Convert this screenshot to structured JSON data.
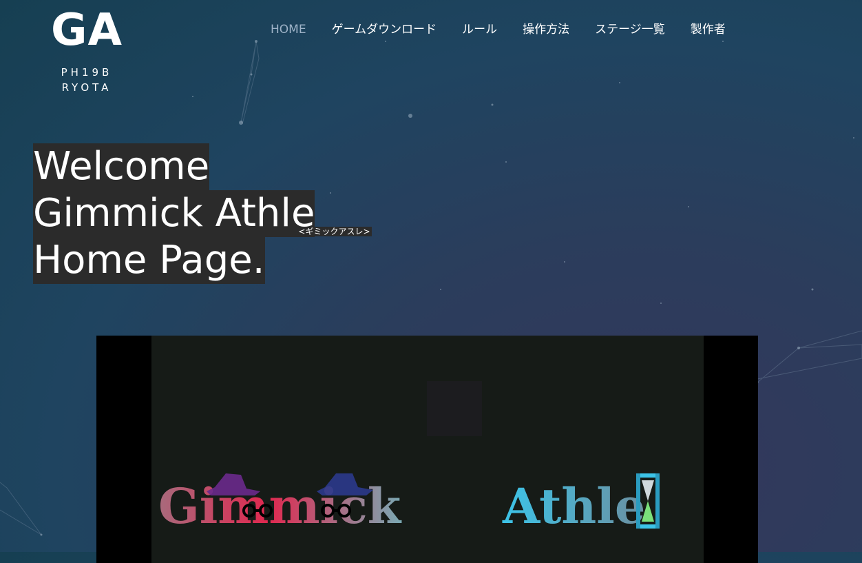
{
  "logo": {
    "main": "GA",
    "line1": "PH19B",
    "line2": "RYOTA"
  },
  "nav": [
    {
      "label": "HOME",
      "active": true
    },
    {
      "label": "ゲームダウンロード"
    },
    {
      "label": "ルール"
    },
    {
      "label": "操作方法"
    },
    {
      "label": "ステージ一覧"
    },
    {
      "label": "製作者"
    }
  ],
  "hero": {
    "line1": "Welcome ",
    "line2": "Gimmick Athle",
    "ruby": "<ギミックアスレ>",
    "line3": "Home Page."
  },
  "video": {
    "title_part1": "Gimmick",
    "title_part2": "Athle"
  },
  "colors": {
    "accent_pink": "#e0284f",
    "accent_cyan": "#3cc4e8",
    "nav_active": "#9fb3c8"
  }
}
